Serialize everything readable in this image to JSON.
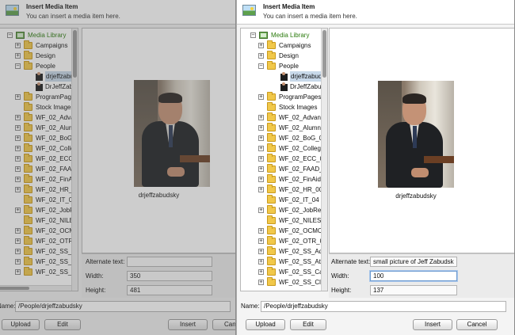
{
  "dialog": {
    "title": "Insert Media Item",
    "subtitle": "You can insert a media item here."
  },
  "tree": {
    "root_label": "Media Library",
    "campaigns": "Campaigns",
    "design": "Design",
    "people": "People",
    "item1": "drjeffzabud",
    "item2": "DrJeffZabu",
    "programpages": "ProgramPages",
    "stock": "Stock Images",
    "advan": "WF_02_Advan",
    "alumn": "WF_02_Alumn",
    "bog": "WF_02_BoG_0",
    "college": "WF_02_Colleg",
    "ecc": "WF_02_ECC_0",
    "faad": "WF_02_FAAD_",
    "finaid": "WF_02_FinAid",
    "hr": "WF_02_HR_00",
    "it": "WF_02_IT_04",
    "jobrel": "WF_02_JobRel",
    "niles": "WF_02_NILES_",
    "ocmc": "WF_02_OCMC_",
    "otr": "WF_02_OTR_0",
    "ssad": "WF_02_SS_Ad",
    "ssath": "WF_02_SS_Ath",
    "ssca": "WF_02_SS_Ca",
    "sscl": "WF_02_SS_Cl"
  },
  "preview": {
    "caption": "drjeffzabudsky"
  },
  "left": {
    "alt_label": "Alternate text:",
    "alt_value": "",
    "width_label": "Width:",
    "width_value": "350",
    "height_label": "Height:",
    "height_value": "481",
    "name_label": "Name:",
    "name_value": "/People/drjeffzabudsky"
  },
  "right": {
    "alt_label": "Alternate text:",
    "alt_value": "small picture of Jeff Zabudsk",
    "width_label": "Width:",
    "width_value": "100",
    "height_label": "Height:",
    "height_value": "137",
    "name_label": "Name:",
    "name_value": "/People/drjeffzabudsky"
  },
  "buttons": {
    "upload": "Upload",
    "edit": "Edit",
    "insert": "Insert",
    "cancel": "Cancel",
    "cancel_cut": "Canc"
  }
}
